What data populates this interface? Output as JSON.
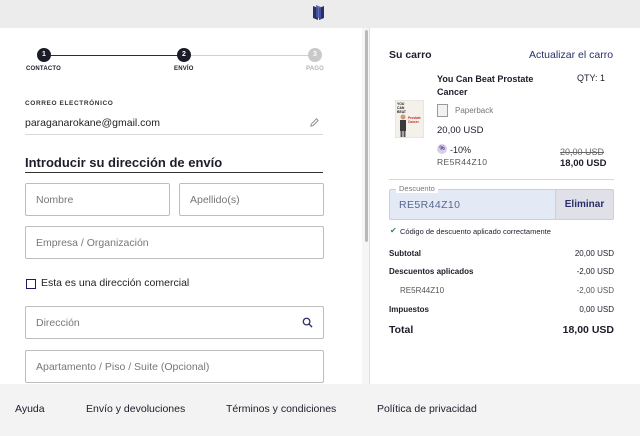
{
  "steps": [
    {
      "number": "1",
      "label": "CONTACTO"
    },
    {
      "number": "2",
      "label": "ENVÍO"
    },
    {
      "number": "3",
      "label": "PAGO"
    }
  ],
  "contact": {
    "email_label": "CORREO ELECTRÓNICO",
    "email_value": "paraganarokane@gmail.com"
  },
  "shipping": {
    "title": "Introducir su dirección de envío",
    "first_name_placeholder": "Nombre",
    "last_name_placeholder": "Apellido(s)",
    "company_placeholder": "Empresa / Organización",
    "commercial_label": "Esta es una dirección comercial",
    "address_placeholder": "Dirección",
    "apartment_placeholder": "Apartamento / Piso / Suite (Opcional)"
  },
  "cart": {
    "title": "Su carro",
    "update_link": "Actualizar el carro",
    "item": {
      "title": "You Can Beat Prostate Cancer",
      "qty": "QTY: 1",
      "format": "Paperback",
      "price": "20,00 USD",
      "discount_badge": "%",
      "discount_pct": "-10%",
      "discount_code": "RE5R44Z10",
      "old_price": "20,00 USD",
      "new_price": "18,00 USD",
      "cover_text": [
        "YOU",
        "CAN",
        "BEAT",
        "Prostate",
        "Cancer"
      ]
    },
    "discount": {
      "legend": "Descuento",
      "value": "RE5R44Z10",
      "remove_label": "Eliminar",
      "success_msg": "Código de descuento aplicado correctamente"
    },
    "summary": {
      "subtotal_label": "Subtotal",
      "subtotal_value": "20,00 USD",
      "applied_label": "Descuentos aplicados",
      "applied_value": "-2,00 USD",
      "code_label": "RE5R44Z10",
      "code_value": "-2,00 USD",
      "taxes_label": "Impuestos",
      "taxes_value": "0,00 USD",
      "total_label": "Total",
      "total_value": "18,00 USD"
    }
  },
  "footer": {
    "links": [
      "Ayuda",
      "Envío y devoluciones",
      "Términos y condiciones",
      "Política de privacidad"
    ]
  },
  "colors": {
    "accent": "#2a2e6a",
    "success": "#2b8a4b",
    "discount_bg": "#e4e9f6"
  }
}
